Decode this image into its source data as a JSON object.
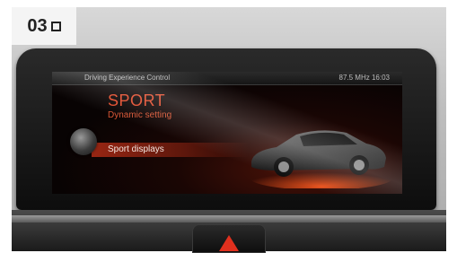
{
  "figure": {
    "number": "03"
  },
  "screen": {
    "header_title": "Driving Experience Control",
    "status": "87.5 MHz  16:03",
    "mode_title": "SPORT",
    "mode_subtitle": "Dynamic setting",
    "menu_items": [
      {
        "label": "Sport displays",
        "selected": true
      }
    ]
  },
  "colors": {
    "accent": "#e24a2a",
    "hazard": "#e0301e"
  }
}
